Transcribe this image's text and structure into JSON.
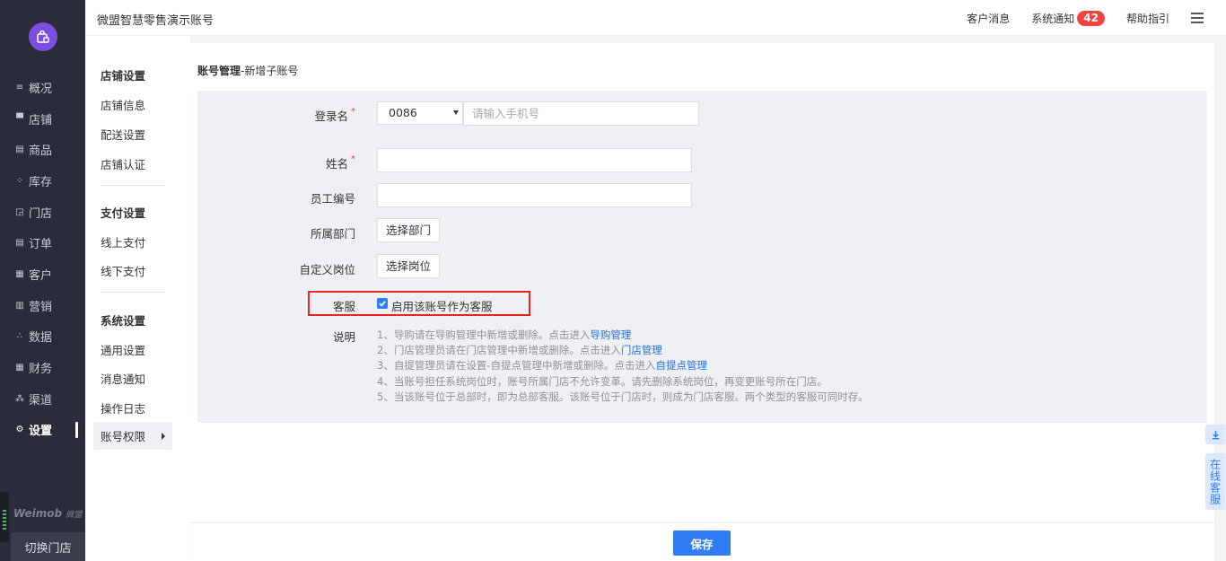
{
  "app": {
    "title": "微盟智慧零售演示账号"
  },
  "header": {
    "customer_msg": "客户消息",
    "system_notice": "系统通知",
    "notice_count": "42",
    "help": "帮助指引"
  },
  "leftnav": {
    "items": [
      {
        "label": "概况",
        "icon": "overview-icon"
      },
      {
        "label": "店铺",
        "icon": "store-icon"
      },
      {
        "label": "商品",
        "icon": "goods-icon"
      },
      {
        "label": "库存",
        "icon": "inventory-icon"
      },
      {
        "label": "门店",
        "icon": "shop-icon"
      },
      {
        "label": "订单",
        "icon": "order-icon"
      },
      {
        "label": "客户",
        "icon": "customer-icon"
      },
      {
        "label": "营销",
        "icon": "marketing-icon"
      },
      {
        "label": "数据",
        "icon": "data-icon"
      },
      {
        "label": "财务",
        "icon": "finance-icon"
      },
      {
        "label": "渠道",
        "icon": "channel-icon"
      },
      {
        "label": "设置",
        "icon": "settings-icon",
        "active": true
      }
    ],
    "brand": "Weimob",
    "brand_sub": "微盟",
    "switch_store": "切换门店"
  },
  "submenu": {
    "group1": "店铺设置",
    "store_info": "店铺信息",
    "delivery": "配送设置",
    "store_cert": "店铺认证",
    "group2": "支付设置",
    "online_pay": "线上支付",
    "offline_pay": "线下支付",
    "group3": "系统设置",
    "general": "通用设置",
    "msg_notice": "消息通知",
    "op_log": "操作日志",
    "account_perm": "账号权限"
  },
  "page": {
    "breadcrumb_main": "账号管理",
    "breadcrumb_sub": "-新增子账号"
  },
  "form": {
    "login_label": "登录名",
    "country_code": "0086",
    "phone_placeholder": "请输入手机号",
    "name_label": "姓名",
    "name_value": "",
    "emp_label": "员工编号",
    "emp_value": "",
    "dept_label": "所属部门",
    "dept_button": "选择部门",
    "post_label": "自定义岗位",
    "post_button": "选择岗位",
    "kefu_label": "客服",
    "kefu_checkbox": "启用该账号作为客服",
    "kefu_checked": true,
    "notes_label": "说明",
    "notes": {
      "n1": "1、导购请在导购管理中新增或删除。点击进入",
      "n1_link": "导购管理",
      "n2": "2、门店管理员请在门店管理中新增或删除。点击进入",
      "n2_link": "门店管理",
      "n3": "3、自提管理员请在设置-自提点管理中新增或删除。点击进入",
      "n3_link": "自提点管理",
      "n4": "4、当账号担任系统岗位时，账号所属门店不允许变革。请先删除系统岗位，再变更账号所在门店。",
      "n5": "5、当该账号位于总部时，即为总部客服。该账号位于门店时，则成为门店客服。两个类型的客服可同时存。"
    }
  },
  "footer": {
    "save": "保存"
  },
  "float": {
    "online_service": "在线客服"
  },
  "colors": {
    "primary": "#2f7cf3",
    "nav_bg": "#2a2d39",
    "highlight_border": "#e8251f",
    "badge": "#f5413f"
  }
}
